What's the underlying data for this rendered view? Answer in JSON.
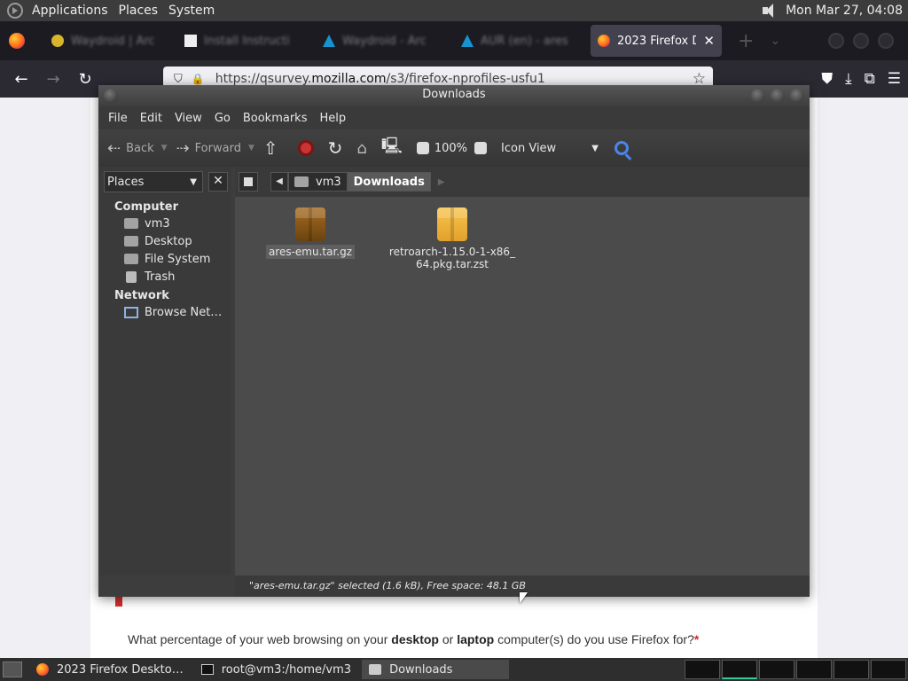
{
  "top_panel": {
    "menus": [
      "Applications",
      "Places",
      "System"
    ],
    "clock": "Mon Mar 27, 04:08"
  },
  "browser": {
    "tabs": [
      {
        "title": "Waydroid | Arc",
        "favicon_color": "#d8b52a"
      },
      {
        "title": "Install Instructi",
        "favicon_color": "#eeeeee"
      },
      {
        "title": "Waydroid - Arc",
        "favicon_color": "#1793d1"
      },
      {
        "title": "AUR (en) - ares",
        "favicon_color": "#1793d1"
      },
      {
        "title": "2023 Firefox De",
        "favicon_color": "#ff7139",
        "active": true
      }
    ],
    "url_prefix": "https://qsurvey.",
    "url_domain": "mozilla.com",
    "url_path": "/s3/firefox-nprofiles-usfu1"
  },
  "page": {
    "question_pre": "What percentage of your web browsing on your ",
    "question_b1": "desktop",
    "question_mid": " or ",
    "question_b2": "laptop",
    "question_post": " computer(s) do you use Firefox for?",
    "required_mark": "*"
  },
  "file_manager": {
    "title": "Downloads",
    "menu": [
      "File",
      "Edit",
      "View",
      "Go",
      "Bookmarks",
      "Help"
    ],
    "toolbar": {
      "back": "Back",
      "forward": "Forward",
      "zoom": "100%",
      "view_mode": "Icon View"
    },
    "sidebar": {
      "selector": "Places",
      "sections": [
        {
          "title": "Computer",
          "items": [
            "vm3",
            "Desktop",
            "File System",
            "Trash"
          ]
        },
        {
          "title": "Network",
          "items": [
            "Browse Net…"
          ]
        }
      ]
    },
    "path": [
      "vm3",
      "Downloads"
    ],
    "files": [
      {
        "name": "ares-emu.tar.gz",
        "icon": "package-brown-icon",
        "selected": true
      },
      {
        "name_line1": "retroarch-1.15.0-1-x86_",
        "name_line2": "64.pkg.tar.zst",
        "icon": "package-yellow-icon",
        "selected": false
      }
    ],
    "status": "\"ares-emu.tar.gz\" selected (1.6 kB), Free space: 48.1 GB"
  },
  "taskbar": {
    "tasks": [
      "2023 Firefox Deskto…",
      "root@vm3:/home/vm3",
      "Downloads"
    ]
  }
}
